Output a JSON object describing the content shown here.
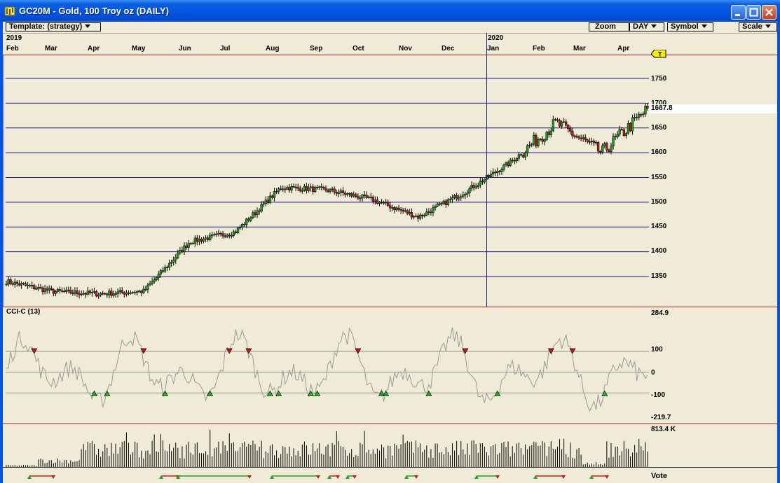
{
  "window": {
    "title": "GC20M - Gold, 100 Troy oz (DAILY)",
    "colors": {
      "titlebar": "#0054e3",
      "bg": "#efebd6",
      "grid": "#1a1a8a",
      "up": "#1ea01e",
      "down": "#c81818",
      "divider": "#a02020"
    }
  },
  "toolbar": {
    "template_label": "Template: (strategy)",
    "zoom_label": "Zoom",
    "period_label": "DAY",
    "symbol_label": "Symbol",
    "scale_label": "Scale"
  },
  "time_axis": {
    "year_start": "2019",
    "year_next": "2020",
    "months_2019": [
      "Feb",
      "Mar",
      "Apr",
      "May",
      "Jun",
      "Jul",
      "Aug",
      "Sep",
      "Oct",
      "Nov",
      "Dec"
    ],
    "months_2020": [
      "Jan",
      "Feb",
      "Mar",
      "Apr"
    ]
  },
  "price_axis": {
    "ticks": [
      "1750",
      "1700",
      "1650",
      "1600",
      "1550",
      "1500",
      "1450",
      "1400",
      "1350"
    ],
    "last_price": "1687.8",
    "marker": "T"
  },
  "cci": {
    "title": "CCI-C (13)",
    "max_label": "284.9",
    "upper_label": "100",
    "zero_label": "0",
    "lower_label": "-100",
    "min_label": "-219.7"
  },
  "volume": {
    "max_label": "813.4 K"
  },
  "vote": {
    "label": "Vote"
  },
  "chart_data": {
    "type": "candlestick",
    "symbol": "GC20M",
    "period": "DAILY",
    "x_range": [
      "2019-02",
      "2020-04"
    ],
    "price_ylim": [
      1300,
      1800
    ],
    "price_anchors": [
      {
        "month": "Feb 2019",
        "close": 1340
      },
      {
        "month": "Mar 2019",
        "close": 1320
      },
      {
        "month": "Apr 2019",
        "close": 1315
      },
      {
        "month": "May 2019",
        "close": 1320
      },
      {
        "month": "Jun 2019",
        "close": 1420
      },
      {
        "month": "Jul 2019",
        "close": 1440
      },
      {
        "month": "Aug 2019",
        "close": 1530
      },
      {
        "month": "Sep 2019",
        "close": 1525
      },
      {
        "month": "Oct 2019",
        "close": 1505
      },
      {
        "month": "Nov 2019",
        "close": 1470
      },
      {
        "month": "Dec 2019",
        "close": 1520
      },
      {
        "month": "Jan 2020",
        "close": 1580
      },
      {
        "month": "Feb 2020",
        "close": 1660
      },
      {
        "month": "Mar 2020",
        "close": 1600
      },
      {
        "month": "Apr 2020",
        "close": 1688
      }
    ],
    "cci_ylim": [
      -219.7,
      284.9
    ],
    "cci_levels": [
      100,
      0,
      -100
    ],
    "volume_max": "813.4 K"
  }
}
